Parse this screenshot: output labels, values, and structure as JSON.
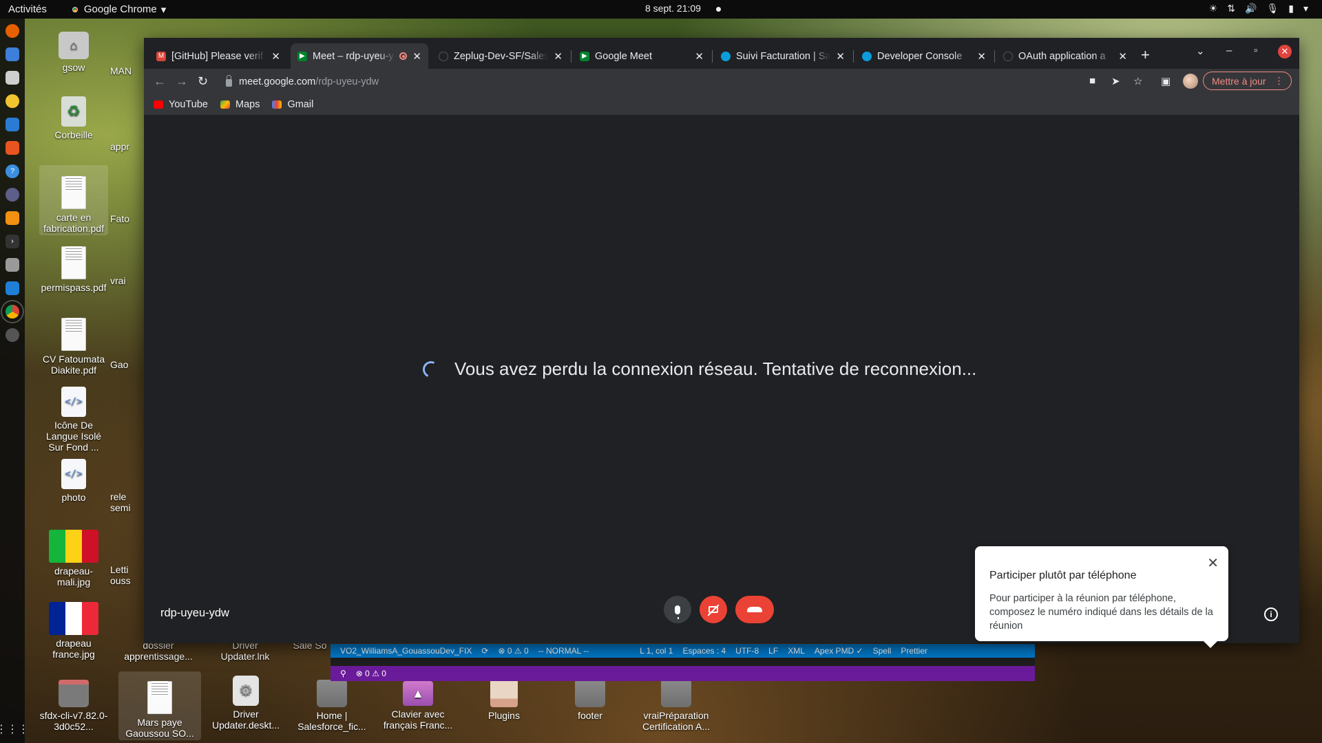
{
  "topbar": {
    "activities": "Activités",
    "app_name": "Google Chrome",
    "clock": "8 sept. 21:09"
  },
  "desktop_icons": [
    {
      "label": "gsow",
      "kind": "home"
    },
    {
      "label": "Corbeille",
      "kind": "trash"
    },
    {
      "label": "carte en fabrication.pdf",
      "kind": "doc"
    },
    {
      "label": "permispass.pdf",
      "kind": "doc"
    },
    {
      "label": "CV Fatoumata Diakite.pdf",
      "kind": "doc"
    },
    {
      "label": "Icône De Langue Isolé Sur Fond ...",
      "kind": "code"
    },
    {
      "label": "photo",
      "kind": "code"
    },
    {
      "label": "drapeau-mali.jpg",
      "kind": "flag-mali"
    },
    {
      "label": "drapeau france.jpg",
      "kind": "flag-fr"
    },
    {
      "label": "sfdx-cli-v7.82.0-3d0c52...",
      "kind": "folder"
    },
    {
      "label": "Mars paye Gaoussou SO...",
      "kind": "doc"
    },
    {
      "label": "Driver Updater.deskt...",
      "kind": "gear"
    },
    {
      "label": "Home | Salesforce_fic...",
      "kind": "folder"
    },
    {
      "label": "Clavier avec français Franc...",
      "kind": "purple"
    },
    {
      "label": "Plugins",
      "kind": "plugins"
    },
    {
      "label": "footer",
      "kind": "folder"
    },
    {
      "label": "vraiPréparation Certification A...",
      "kind": "folder"
    }
  ],
  "partial_icons": [
    {
      "label": "MAN"
    },
    {
      "label": "appr"
    },
    {
      "label": "Fato"
    },
    {
      "label": "vrai"
    },
    {
      "label": "Gao"
    },
    {
      "label": "rele semi"
    },
    {
      "label": "Letti ouss"
    },
    {
      "label": "dossier apprentissage..."
    },
    {
      "label": "Driver Updater.lnk"
    },
    {
      "label": "Sale So"
    }
  ],
  "tabs": [
    {
      "title": "[GitHub] Please verif",
      "favicon_color": "#db4437"
    },
    {
      "title": "Meet – rdp-uyeu-y",
      "favicon_color": "#00832d",
      "active": true
    },
    {
      "title": "Zeplug-Dev-SF/Sales",
      "favicon_color": "#202124"
    },
    {
      "title": "Google Meet",
      "favicon_color": "#00832d"
    },
    {
      "title": "Suivi Facturation | Sa",
      "favicon_color": "#0b9ddb"
    },
    {
      "title": "Developer Console",
      "favicon_color": "#0b9ddb"
    },
    {
      "title": "OAuth application a",
      "favicon_color": "#202124"
    }
  ],
  "toolbar": {
    "url_host": "meet.google.com",
    "url_path": "/rdp-uyeu-ydw",
    "update_label": "Mettre à jour"
  },
  "bookmarks": [
    {
      "label": "YouTube",
      "color": "#ff0000"
    },
    {
      "label": "Maps",
      "color": "#34a853"
    },
    {
      "label": "Gmail",
      "color": "#ea4335"
    }
  ],
  "meet": {
    "reconnect_message": "Vous avez perdu la connexion réseau. Tentative de reconnexion...",
    "meeting_code": "rdp-uyeu-ydw",
    "popup_title": "Participer plutôt par téléphone",
    "popup_body": "Pour participer à la réunion par téléphone, composez le numéro indiqué dans les détails de la réunion"
  },
  "vscode_status": {
    "branch": "VO2_WilliamsA_GouassouDev_FIX",
    "problems": "⊗ 0 ⚠ 0",
    "mode": "-- NORMAL --",
    "position": "L 1, col 1",
    "spaces": "Espaces : 4",
    "encoding": "UTF-8",
    "eol": "LF",
    "language": "XML",
    "apex_pmd": "Apex PMD ✓",
    "spell": "Spell",
    "prettier": "Prettier",
    "problems2": "⊗ 0 ⚠ 0"
  },
  "colors": {
    "accent_blue": "#8ab4f8",
    "danger_red": "#ea4335",
    "vscode_blue": "#007acc",
    "vscode_purple": "#6a1b9a"
  }
}
